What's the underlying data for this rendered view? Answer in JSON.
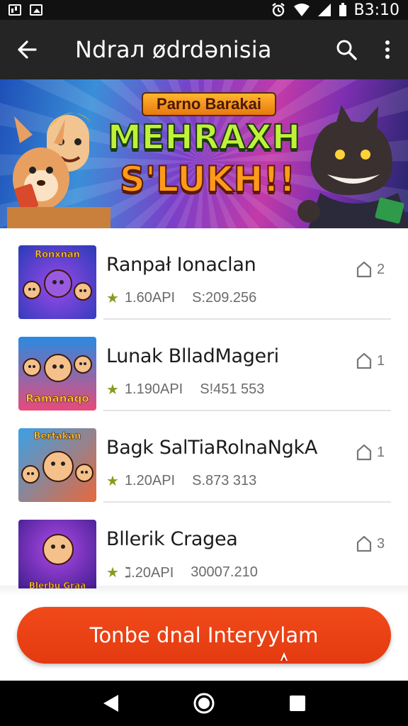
{
  "status_bar": {
    "time": "B3:10",
    "icons": [
      "notification-icon",
      "image-icon",
      "alarm-icon",
      "wifi-icon",
      "signal-icon",
      "battery-icon"
    ]
  },
  "app_bar": {
    "title": "Ndrал ødrdənisia",
    "back_icon": "arrow-back-icon",
    "search_icon": "search-icon",
    "menu_icon": "more-vert-icon"
  },
  "banner": {
    "subtitle": "Parno Barakai",
    "title_line1": "MEHRAXH",
    "title_line2": "S'LUKH!!"
  },
  "list": {
    "items": [
      {
        "title": "Ranpał Ionaclan",
        "rating": "1.60АРІ",
        "value": "S:209.256",
        "count": "2",
        "thumb_label": "Ronxnan"
      },
      {
        "title": "Lunak BlladMageri",
        "rating": "1.190АРІ",
        "value": "S!451 553",
        "count": "1",
        "thumb_label": "Ramanaqo"
      },
      {
        "title": "Bagk SalTiaRolnaNgkA",
        "rating": "1.20АРІ",
        "value": "S.873 313",
        "count": "1",
        "thumb_label": "Bertakan"
      },
      {
        "title": "Bllerik Cragea",
        "rating": "ℷ.20АРІ",
        "value": "30007.210",
        "count": "3",
        "thumb_label": "Blerbu Graa"
      }
    ]
  },
  "cta": {
    "label": "Tonbe dnal Interyylam"
  },
  "nav_bar": {
    "icons": [
      "back-triangle-icon",
      "home-circle-icon",
      "recents-square-icon"
    ]
  },
  "colors": {
    "accent": "#e84318",
    "app_bar": "#252525",
    "rating_star": "#8a9a1e"
  }
}
